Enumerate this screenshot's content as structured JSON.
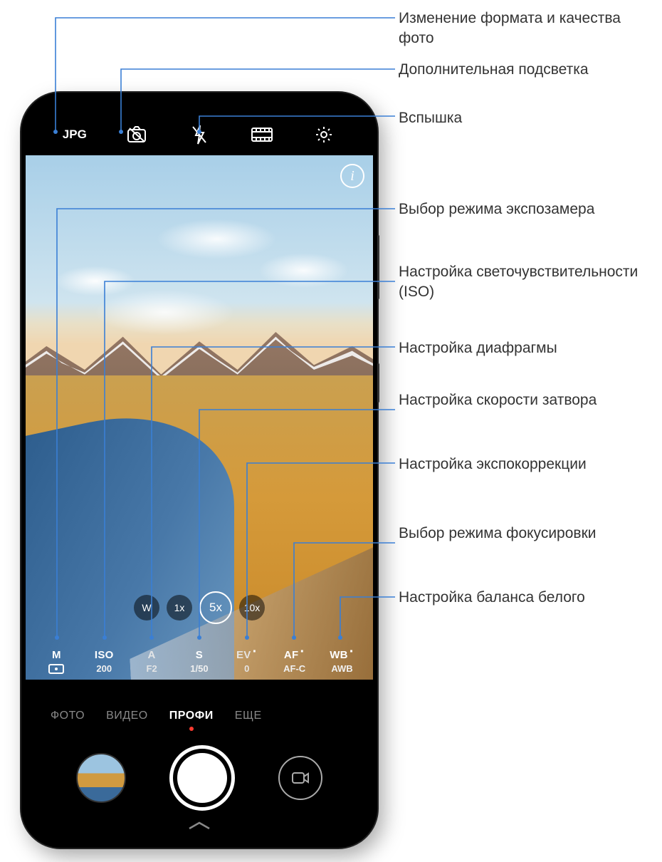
{
  "topbar": {
    "format_label": "JPG"
  },
  "zoom": {
    "items": [
      {
        "label": "W"
      },
      {
        "label": "1x"
      },
      {
        "label": "5x",
        "active": true
      },
      {
        "label": "10x"
      }
    ]
  },
  "pro_params": [
    {
      "key": "M",
      "label": "M",
      "value_icon": "metering"
    },
    {
      "key": "ISO",
      "label": "ISO",
      "value": "200"
    },
    {
      "key": "A",
      "label": "A",
      "value": "F2"
    },
    {
      "key": "S",
      "label": "S",
      "value": "1/50"
    },
    {
      "key": "EV",
      "label": "EV",
      "value": "0",
      "dot": true
    },
    {
      "key": "AF",
      "label": "AF",
      "value": "AF-C",
      "dot": true
    },
    {
      "key": "WB",
      "label": "WB",
      "value": "AWB",
      "dot": true
    }
  ],
  "modes": {
    "items": [
      {
        "label": "ФОТО"
      },
      {
        "label": "ВИДЕО"
      },
      {
        "label": "ПРОФИ",
        "active": true
      },
      {
        "label": "ЕЩЕ"
      }
    ]
  },
  "callouts": {
    "format": "Изменение формата и качества фото",
    "fill": "Дополнительная подсветка",
    "flash": "Вспышка",
    "metering": "Выбор режима экспозамера",
    "iso": "Настройка светочувствительности (ISO)",
    "aperture": "Настройка диафрагмы",
    "shutter": "Настройка  скорости затвора",
    "ev": "Настройка экспокоррекции",
    "af": "Выбор режима фокусировки",
    "wb": "Настройка баланса белого"
  }
}
